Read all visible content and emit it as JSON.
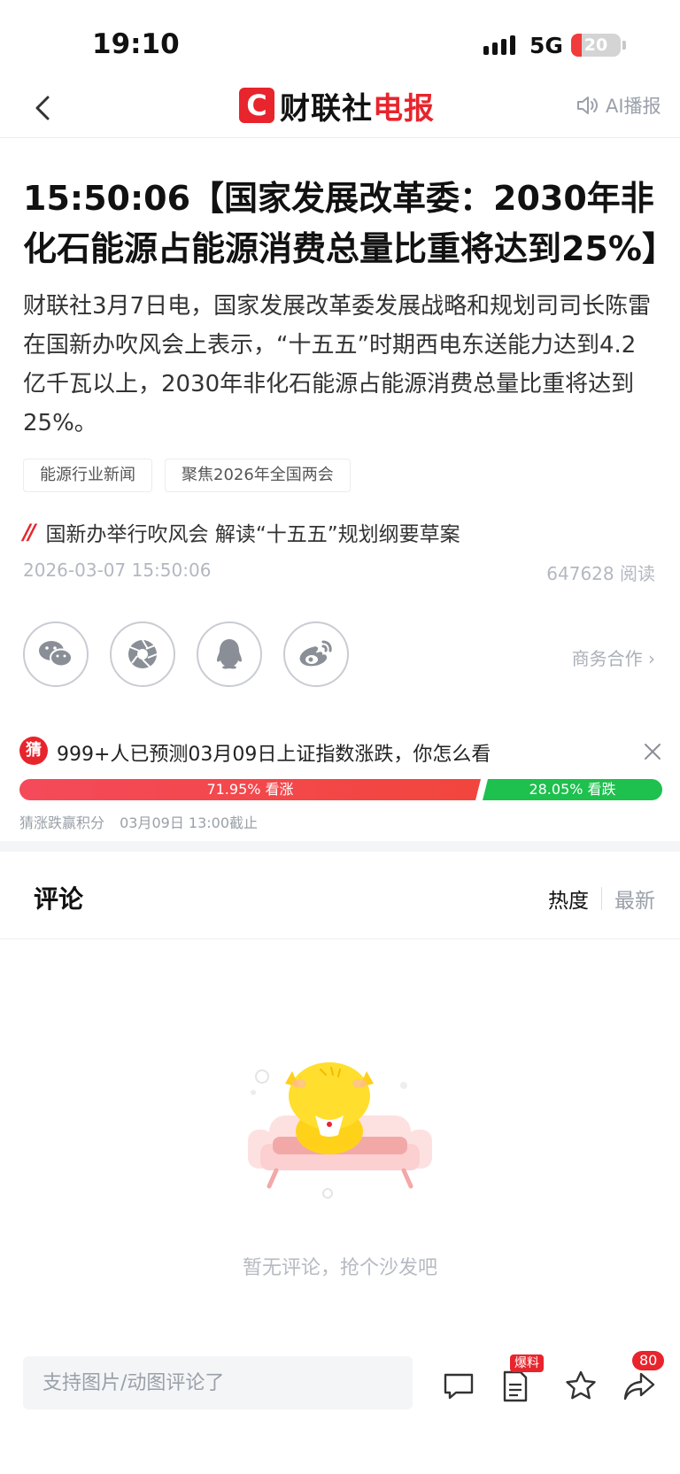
{
  "status_bar": {
    "time": "19:10",
    "network": "5G",
    "battery": "20"
  },
  "nav": {
    "logo_mark": "C",
    "logo_text_black": "财联社",
    "logo_text_red": "电报",
    "ai_play": "AI播报"
  },
  "article": {
    "headline": "15:50:06【国家发展改革委：2030年非化石能源占能源消费总量比重将达到25%】",
    "body": "财联社3月7日电，国家发展改革委发展战略和规划司司长陈雷在国新办吹风会上表示，“十五五”时期西电东送能力达到4.2亿千瓦以上，2030年非化石能源占能源消费总量比重将达到25%。",
    "tags": [
      "能源行业新闻",
      "聚焦2026年全国两会"
    ],
    "topic": "国新办举行吹风会 解读“十五五”规划纲要草案",
    "datetime": "2026-03-07 15:50:06",
    "reads": "647628 阅读"
  },
  "share": {
    "business": "商务合作 ›"
  },
  "guess": {
    "badge": "猜",
    "title": "999+人已预测03月09日上证指数涨跌，你怎么看",
    "up_percent": 71.95,
    "down_percent": 28.05,
    "up_label": "71.95% 看涨",
    "down_label": "28.05% 看跌",
    "footer_left": "猜涨跌赢积分",
    "footer_right": "03月09日 13:00截止"
  },
  "comments": {
    "title": "评论",
    "sort_hot": "热度",
    "sort_new": "最新",
    "empty": "暂无评论，抢个沙发吧"
  },
  "bottom_bar": {
    "input_placeholder": "支持图片/动图评论了",
    "report_badge": "爆料",
    "share_count": "80"
  },
  "colors": {
    "brand_red": "#e8242c",
    "up_red": "#f2453d",
    "down_green": "#1ec04e"
  }
}
